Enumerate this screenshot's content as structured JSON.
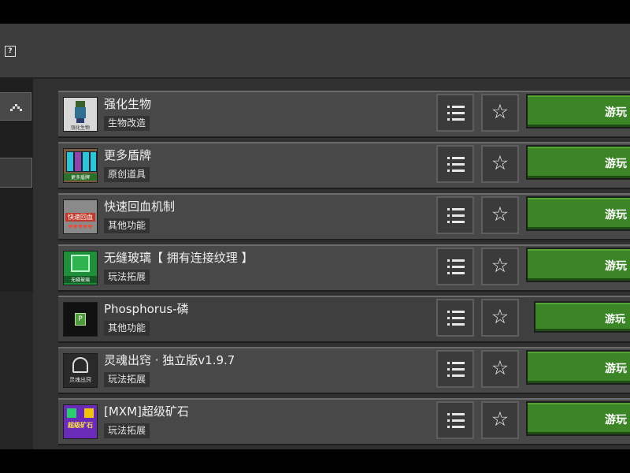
{
  "header": {
    "help_icon": "?"
  },
  "sidebar": {
    "collapse_icon": "chevron-up-icon"
  },
  "items": [
    {
      "title": "强化生物",
      "tag": "生物改造",
      "thumb_caption": "强化生物",
      "menu_icon": "list-icon",
      "fav_icon": "star-icon",
      "action": "游玩"
    },
    {
      "title": "更多盾牌",
      "tag": "原创道具",
      "thumb_caption": "更多盾牌",
      "menu_icon": "list-icon",
      "fav_icon": "star-icon",
      "action": "游玩"
    },
    {
      "title": "快速回血机制",
      "tag": "其他功能",
      "thumb_caption": "快速回血",
      "menu_icon": "list-icon",
      "fav_icon": "star-icon",
      "action": "游玩"
    },
    {
      "title": "无缝玻璃【 拥有连接纹理 】",
      "tag": "玩法拓展",
      "thumb_caption": "无缝玻璃",
      "menu_icon": "list-icon",
      "fav_icon": "star-icon",
      "action": "游玩"
    },
    {
      "title": "Phosphorus-磷",
      "tag": "其他功能",
      "thumb_caption": "P",
      "menu_icon": "list-icon",
      "fav_icon": "star-icon",
      "action": "游玩"
    },
    {
      "title": "灵魂出窍 · 独立版v1.9.7",
      "tag": "玩法拓展",
      "thumb_caption": "灵魂出窍",
      "menu_icon": "list-icon",
      "fav_icon": "star-icon",
      "action": "游玩"
    },
    {
      "title": "[MXM]超级矿石",
      "tag": "玩法拓展",
      "thumb_caption": "超级矿石",
      "menu_icon": "list-icon",
      "fav_icon": "star-icon",
      "action": "游玩"
    }
  ]
}
